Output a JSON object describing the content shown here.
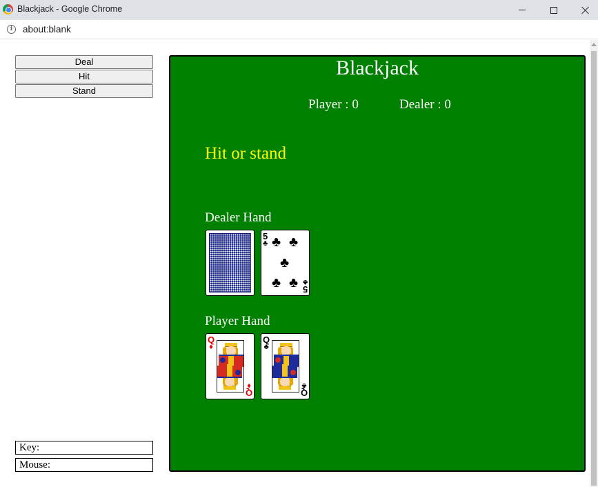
{
  "window": {
    "title": "Blackjack - Google Chrome",
    "url": "about:blank"
  },
  "controls": {
    "deal_label": "Deal",
    "hit_label": "Hit",
    "stand_label": "Stand",
    "key_label": "Key:",
    "mouse_label": "Mouse:"
  },
  "game": {
    "title": "Blackjack",
    "player_score_label": "Player : 0",
    "dealer_score_label": "Dealer : 0",
    "status": "Hit or stand",
    "dealer_hand_label": "Dealer Hand",
    "player_hand_label": "Player Hand",
    "dealer_cards": [
      {
        "face": "back"
      },
      {
        "rank": "5",
        "suit": "♣",
        "suit_name": "clubs",
        "color": "#000000"
      }
    ],
    "player_cards": [
      {
        "rank": "Q",
        "suit": "♦",
        "suit_name": "diamonds",
        "color": "#e00000"
      },
      {
        "rank": "Q",
        "suit": "♣",
        "suit_name": "clubs",
        "color": "#000000"
      }
    ]
  },
  "colors": {
    "table_green": "#008000",
    "status_yellow": "#ffff00",
    "card_back_blue": "#1f2b8f"
  }
}
